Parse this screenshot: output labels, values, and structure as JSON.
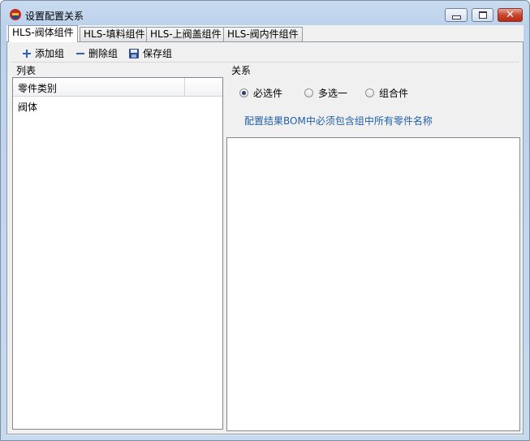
{
  "window": {
    "title": "设置配置关系",
    "controls": {
      "minimize": "minimize",
      "maximize": "maximize",
      "close": "close"
    }
  },
  "tabs": [
    {
      "label": "HLS-阀体组件",
      "active": true
    },
    {
      "label": "HLS-填料组件",
      "active": false
    },
    {
      "label": "HLS-上阀盖组件",
      "active": false
    },
    {
      "label": "HLS-阀内件组件",
      "active": false
    }
  ],
  "toolbar": {
    "add_label": "添加组",
    "delete_label": "删除组",
    "save_label": "保存组"
  },
  "list_panel": {
    "label": "列表",
    "column_header": "零件类别",
    "rows": [
      "阀体"
    ]
  },
  "relation_panel": {
    "label": "关系",
    "options": [
      {
        "label": "必选件",
        "selected": true
      },
      {
        "label": "多选一",
        "selected": false
      },
      {
        "label": "组合件",
        "selected": false
      }
    ],
    "hint": "配置结果BOM中必须包含组中所有零件名称"
  },
  "colors": {
    "hint_text": "#2360a8",
    "close_button": "#c9452f"
  },
  "icons": [
    "app-logo-icon",
    "plus-icon",
    "minus-icon",
    "floppy-disk-icon"
  ]
}
